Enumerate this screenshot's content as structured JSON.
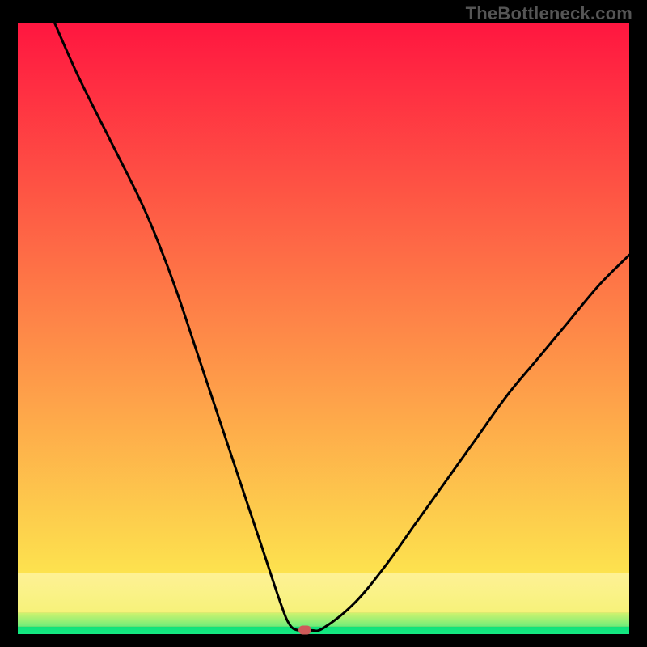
{
  "watermark": "TheBottleneck.com",
  "chart_data": {
    "type": "line",
    "title": "",
    "xlabel": "",
    "ylabel": "",
    "xlim": [
      0,
      100
    ],
    "ylim": [
      0,
      100
    ],
    "grid": false,
    "series": [
      {
        "name": "curve",
        "x": [
          6,
          10,
          15,
          20,
          23,
          26,
          30,
          34,
          37,
          40,
          43,
          44.5,
          46,
          48,
          50,
          55,
          60,
          65,
          70,
          75,
          80,
          85,
          90,
          95,
          100
        ],
        "y": [
          100,
          91,
          81,
          71,
          64,
          56,
          44,
          32,
          23,
          14,
          5,
          1.5,
          0.6,
          0.6,
          1,
          5,
          11,
          18,
          25,
          32,
          39,
          45,
          51,
          57,
          62
        ]
      }
    ],
    "bands": [
      {
        "name": "green",
        "y0": 0.0,
        "y1": 1.2,
        "color_top": "#0fe27a",
        "color_bottom": "#14e882"
      },
      {
        "name": "yellowgreen",
        "y0": 1.2,
        "y1": 3.5,
        "color_top": "#d2f26e",
        "color_bottom": "#6ced7a"
      },
      {
        "name": "paleyellow",
        "y0": 3.5,
        "y1": 10,
        "color_top": "#fef195",
        "color_bottom": "#f6f27a"
      },
      {
        "name": "gradient",
        "y0": 10,
        "y1": 100,
        "color_top": "#ff1640",
        "color_bottom": "#fde24e"
      }
    ],
    "marker": {
      "x": 47,
      "y": 0.6,
      "color": "#cf5a5a"
    }
  }
}
